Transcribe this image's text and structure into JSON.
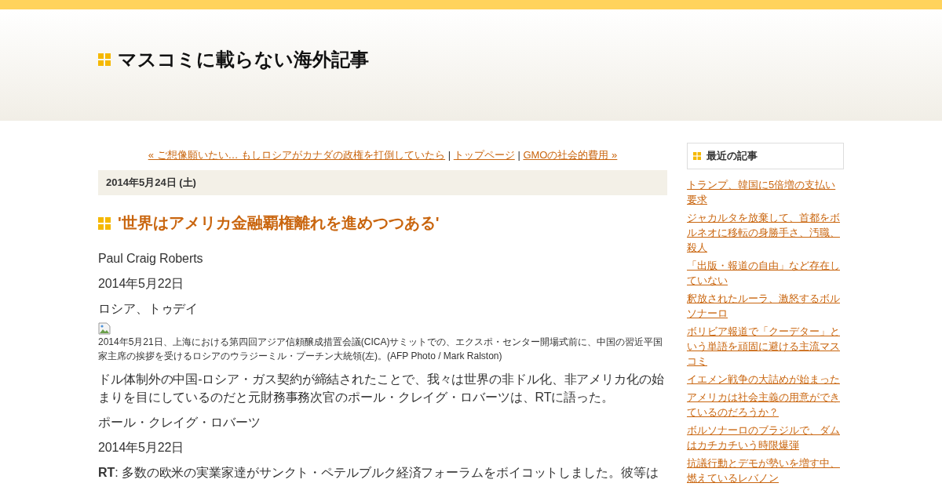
{
  "site": {
    "title": "マスコミに載らない海外記事"
  },
  "nav": {
    "prev": "« ご想像願いたい… もしロシアがカナダの政権を打倒していたら",
    "separator_1": "|",
    "home": "トップページ",
    "separator_2": "|",
    "next": "GMOの社会的費用 »"
  },
  "post": {
    "date": "2014年5月24日 (土)",
    "title": "'世界はアメリカ金融覇権離れを進めつつある'",
    "paragraphs": [
      {
        "kind": "text",
        "text": "Paul Craig Roberts"
      },
      {
        "kind": "text",
        "text": "2014年5月22日"
      },
      {
        "kind": "text",
        "text": "ロシア、トゥデイ"
      },
      {
        "kind": "image",
        "caption": "2014年5月21日、上海における第四回アジア信頼醸成措置会議(CICA)サミットでの、エクスポ・センター開場式前に、中国の習近平国家主席の挨拶を受けるロシアのウラジーミル・プーチン大統領(左)。(AFP Photo / Mark Ralston)"
      },
      {
        "kind": "text",
        "text": "ドル体制外の中国-ロシア・ガス契約が締結されたことで、我々は世界の非ドル化、非アメリカ化の始まりを目にしているのだと元財務事務次官のポール・クレイグ・ロバーツは、RTに語った。"
      },
      {
        "kind": "text",
        "text": "ポール・クレイグ・ロバーツ"
      },
      {
        "kind": "text",
        "text": "2014年5月22日"
      },
      {
        "kind": "text",
        "text": "**RT**: 多数の欧米の実業家達がサンクト・ペテルブルク経済フォーラムをボイコットしました。彼等は"
      }
    ]
  },
  "sidebar": {
    "heading": "最近の記事",
    "items": [
      "トランプ、韓国に5倍増の支払い要求",
      "ジャカルタを放棄して、首都をボルネオに移転の身勝手さ、汚職、殺人",
      "「出版・報道の自由」など存在していない",
      "釈放されたルーラ、激怒するボルソナーロ",
      "ボリビア報道で「クーデター」という単語を頑固に避ける主流マスコミ",
      "イエメン戦争の大詰めが始まった",
      "アメリカは社会主義の用意ができているのだろうか？",
      "ボルソナーロのブラジルで、ダムはカチカチいう時限爆弾",
      "抗議行動とデモが勢いを増す中、燃えているレバノン"
    ]
  }
}
